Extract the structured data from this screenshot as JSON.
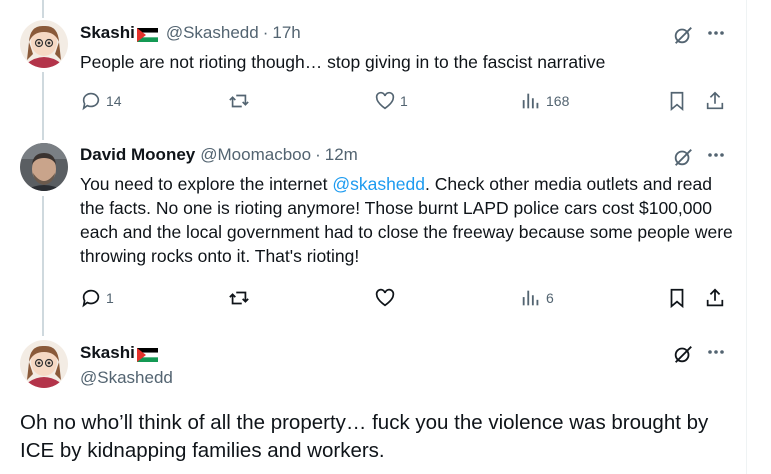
{
  "tweets": [
    {
      "name": "Skashi",
      "handle": "@Skashedd",
      "time": "17h",
      "text_parts": [
        "People are not rioting though… stop giving in to the fascist narrative"
      ],
      "replies": "14",
      "retweets": "",
      "likes": "1",
      "views": "168"
    },
    {
      "name": "David Mooney",
      "handle": "@Moomacboo",
      "time": "12m",
      "text_before": "You need to explore the internet ",
      "mention": "@skashedd",
      "text_after": ". Check other media outlets and read the facts. No one is rioting anymore! Those burnt LAPD police cars cost $100,000 each and the local government had to close the freeway because some people were throwing rocks onto it. That's rioting!",
      "replies": "1",
      "retweets": "",
      "likes": "",
      "views": "6"
    }
  ],
  "main_tweet": {
    "name": "Skashi",
    "handle": "@Skashedd",
    "text": "Oh no who’ll think of all the property… fuck you the violence was brought by ICE by kidnapping families and workers."
  },
  "icons": [
    "reply-icon",
    "retweet-icon",
    "like-icon",
    "views-icon",
    "bookmark-icon",
    "share-icon",
    "grok-icon",
    "more-icon",
    "palestine-flag-icon"
  ],
  "colors": {
    "text": "#0f1419",
    "secondary": "#536471",
    "link": "#1d9bf0",
    "thread_line": "#cfd9de"
  }
}
